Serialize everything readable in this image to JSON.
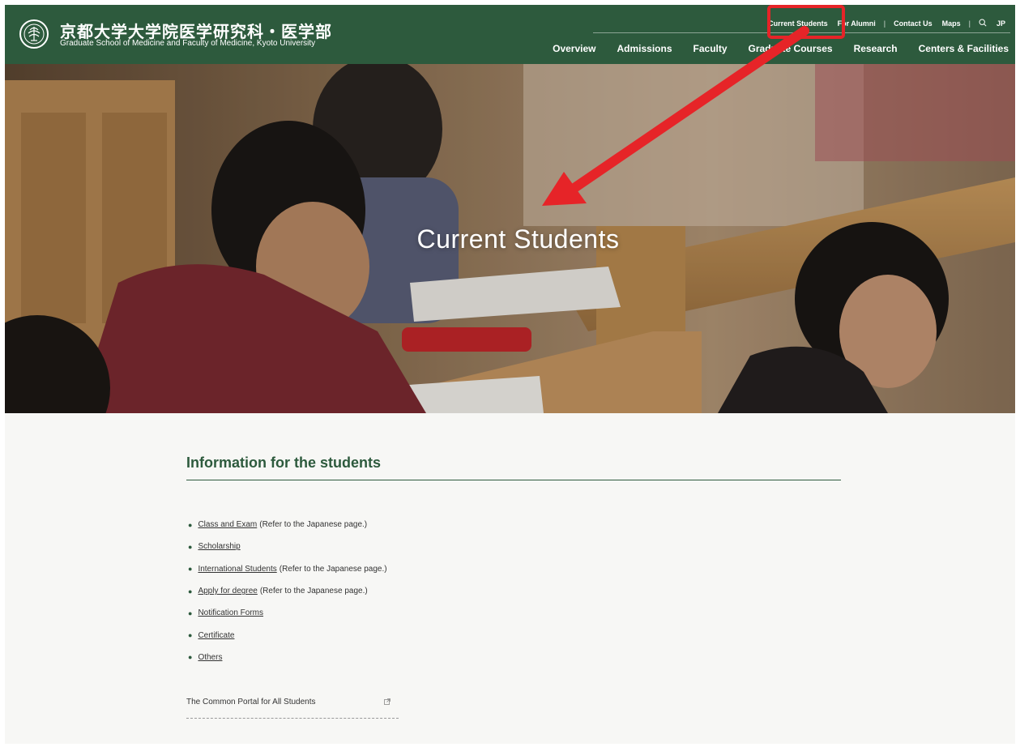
{
  "header": {
    "title_jp": "京都大学大学院医学研究科・医学部",
    "title_en": "Graduate School of Medicine and Faculty of Medicine, Kyoto University",
    "logo_icon": "kyoto-university-emblem-icon",
    "utility_nav": {
      "current_students": "Current Students",
      "for_alumni": "For Alumni",
      "contact_us": "Contact Us",
      "maps": "Maps",
      "search_icon": "search-icon",
      "language": "JP",
      "separator": "|"
    },
    "main_nav": [
      "Overview",
      "Admissions",
      "Faculty",
      "Graduate Courses",
      "Research",
      "Centers & Facilities"
    ]
  },
  "hero": {
    "title": "Current Students"
  },
  "content": {
    "heading": "Information for the students",
    "items": [
      {
        "link": "Class and Exam",
        "note": "(Refer to the Japanese page.)"
      },
      {
        "link": "Scholarship",
        "note": ""
      },
      {
        "link": "International Students",
        "note": "(Refer to the Japanese page.)"
      },
      {
        "link": "Apply for degree",
        "note": "(Refer to the Japanese page.)"
      },
      {
        "link": "Notification Forms",
        "note": ""
      },
      {
        "link": "Certificate",
        "note": ""
      },
      {
        "link": "Others",
        "note": ""
      }
    ],
    "portal_label": "The Common Portal for All Students",
    "portal_icon": "external-link-icon"
  },
  "colors": {
    "brand_green": "#2d5a3d",
    "highlight_red": "#e62428",
    "page_bg": "#f7f7f5"
  }
}
